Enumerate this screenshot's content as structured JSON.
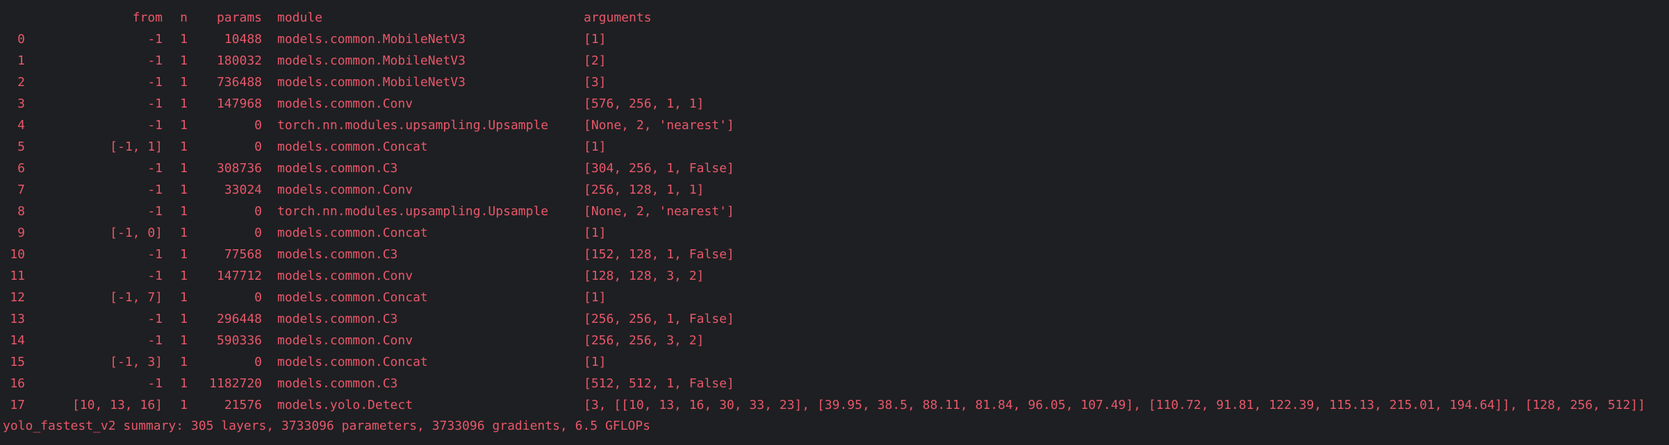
{
  "colors": {
    "background": "#1e1f22",
    "text": "#e8576a"
  },
  "header": {
    "index": "",
    "from": "from",
    "n": "n",
    "params": "params",
    "module": "module",
    "arguments": "arguments"
  },
  "rows": [
    {
      "idx": "0",
      "from": "-1",
      "n": "1",
      "params": "10488",
      "module": "models.common.MobileNetV3",
      "arguments": "[1]"
    },
    {
      "idx": "1",
      "from": "-1",
      "n": "1",
      "params": "180032",
      "module": "models.common.MobileNetV3",
      "arguments": "[2]"
    },
    {
      "idx": "2",
      "from": "-1",
      "n": "1",
      "params": "736488",
      "module": "models.common.MobileNetV3",
      "arguments": "[3]"
    },
    {
      "idx": "3",
      "from": "-1",
      "n": "1",
      "params": "147968",
      "module": "models.common.Conv",
      "arguments": "[576, 256, 1, 1]"
    },
    {
      "idx": "4",
      "from": "-1",
      "n": "1",
      "params": "0",
      "module": "torch.nn.modules.upsampling.Upsample",
      "arguments": "[None, 2, 'nearest']"
    },
    {
      "idx": "5",
      "from": "[-1, 1]",
      "n": "1",
      "params": "0",
      "module": "models.common.Concat",
      "arguments": "[1]"
    },
    {
      "idx": "6",
      "from": "-1",
      "n": "1",
      "params": "308736",
      "module": "models.common.C3",
      "arguments": "[304, 256, 1, False]"
    },
    {
      "idx": "7",
      "from": "-1",
      "n": "1",
      "params": "33024",
      "module": "models.common.Conv",
      "arguments": "[256, 128, 1, 1]"
    },
    {
      "idx": "8",
      "from": "-1",
      "n": "1",
      "params": "0",
      "module": "torch.nn.modules.upsampling.Upsample",
      "arguments": "[None, 2, 'nearest']"
    },
    {
      "idx": "9",
      "from": "[-1, 0]",
      "n": "1",
      "params": "0",
      "module": "models.common.Concat",
      "arguments": "[1]"
    },
    {
      "idx": "10",
      "from": "-1",
      "n": "1",
      "params": "77568",
      "module": "models.common.C3",
      "arguments": "[152, 128, 1, False]"
    },
    {
      "idx": "11",
      "from": "-1",
      "n": "1",
      "params": "147712",
      "module": "models.common.Conv",
      "arguments": "[128, 128, 3, 2]"
    },
    {
      "idx": "12",
      "from": "[-1, 7]",
      "n": "1",
      "params": "0",
      "module": "models.common.Concat",
      "arguments": "[1]"
    },
    {
      "idx": "13",
      "from": "-1",
      "n": "1",
      "params": "296448",
      "module": "models.common.C3",
      "arguments": "[256, 256, 1, False]"
    },
    {
      "idx": "14",
      "from": "-1",
      "n": "1",
      "params": "590336",
      "module": "models.common.Conv",
      "arguments": "[256, 256, 3, 2]"
    },
    {
      "idx": "15",
      "from": "[-1, 3]",
      "n": "1",
      "params": "0",
      "module": "models.common.Concat",
      "arguments": "[1]"
    },
    {
      "idx": "16",
      "from": "-1",
      "n": "1",
      "params": "1182720",
      "module": "models.common.C3",
      "arguments": "[512, 512, 1, False]"
    },
    {
      "idx": "17",
      "from": "[10, 13, 16]",
      "n": "1",
      "params": "21576",
      "module": "models.yolo.Detect",
      "arguments": "[3, [[10, 13, 16, 30, 33, 23], [39.95, 38.5, 88.11, 81.84, 96.05, 107.49], [110.72, 91.81, 122.39, 115.13, 215.01, 194.64]], [128, 256, 512]]"
    }
  ],
  "summary": "yolo_fastest_v2 summary: 305 layers, 3733096 parameters, 3733096 gradients, 6.5 GFLOPs"
}
